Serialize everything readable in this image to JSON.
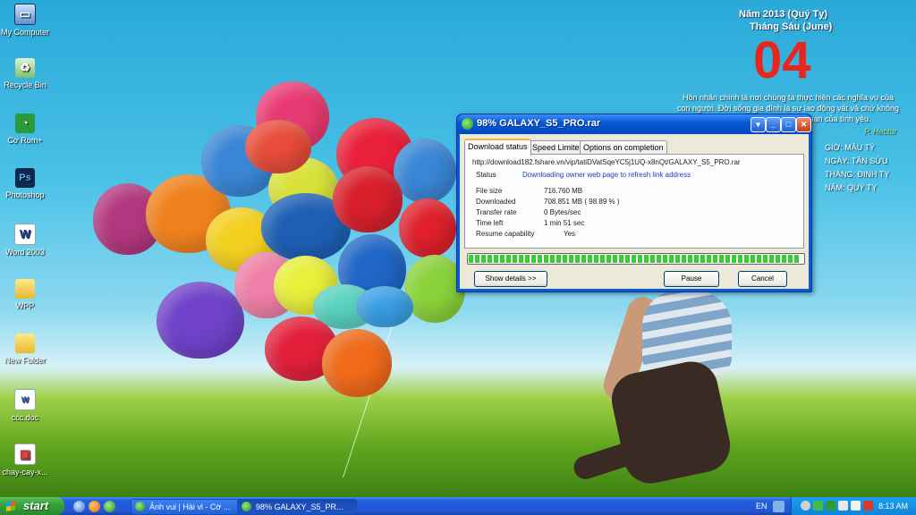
{
  "desktop": {
    "icons": [
      {
        "label": "My Computer",
        "glyph": "computer-icon"
      },
      {
        "label": "Recycle Bin",
        "glyph": "recycle-bin-icon"
      },
      {
        "label": "Cờ Rom+",
        "glyph": "browser-icon"
      },
      {
        "label": "Photoshop",
        "glyph": "photoshop-icon"
      },
      {
        "label": "Word 2003",
        "glyph": "word-icon"
      },
      {
        "label": "WPP",
        "glyph": "folder-icon"
      },
      {
        "label": "New Folder",
        "glyph": "folder-icon"
      },
      {
        "label": "ccc.doc",
        "glyph": "document-icon"
      },
      {
        "label": "chay-cay-x...",
        "glyph": "program-icon"
      }
    ]
  },
  "calendar": {
    "year_line": "Năm 2013 (Quý Tỵ)",
    "month_line": "Tháng Sáu (June)",
    "day": "04",
    "quote": "Hôn nhân chính là nơi chúng ta thực hiện các nghĩa vụ của con người. Đời sống gia đình là sự lao động vất vả chứ không phải một buổi dạo chơi lãng mạn của tình yêu.",
    "author": "P. Hector",
    "lunar_hour": "GIỜ: MẬU TÝ",
    "lunar_day": "NGÀY: TÂN SỬU",
    "lunar_month": "THÁNG: ĐINH TỴ",
    "lunar_year": "NĂM: QUÝ TỴ"
  },
  "dialog": {
    "title": "98% GALAXY_S5_PRO.rar",
    "tabs": [
      "Download status",
      "Speed Limiter",
      "Options on completion"
    ],
    "active_tab": "Download status",
    "url": "http://download182.fshare.vn/vip/tatiDVatSqeYC5j1UQ-x8nQt/GALAXY_S5_PRO.rar",
    "status_label": "Status",
    "status_value": "Downloading owner web page to refresh link address",
    "rows": [
      {
        "label": "File size",
        "value": "716.760  MB"
      },
      {
        "label": "Downloaded",
        "value": "708.851  MB  ( 98.89 % )"
      },
      {
        "label": "Transfer rate",
        "value": "0  Bytes/sec"
      },
      {
        "label": "Time left",
        "value": "1 min 51 sec"
      },
      {
        "label": "Resume capability",
        "value": "Yes"
      }
    ],
    "progress_percent": 98.89,
    "buttons": {
      "show_details": "Show details >>",
      "pause": "Pause",
      "cancel": "Cancel"
    }
  },
  "taskbar": {
    "start_label": "start",
    "tasks": [
      {
        "label": "Ảnh vui | Hài vl - Cờ ..."
      },
      {
        "label": "98% GALAXY_S5_PR..."
      }
    ],
    "language": "EN",
    "clock": "8:13 AM"
  },
  "colors": {
    "accent_red": "#e8261c",
    "progress_green": "#37d033",
    "xp_blue": "#0a5ad8",
    "start_green": "#36a23a"
  }
}
